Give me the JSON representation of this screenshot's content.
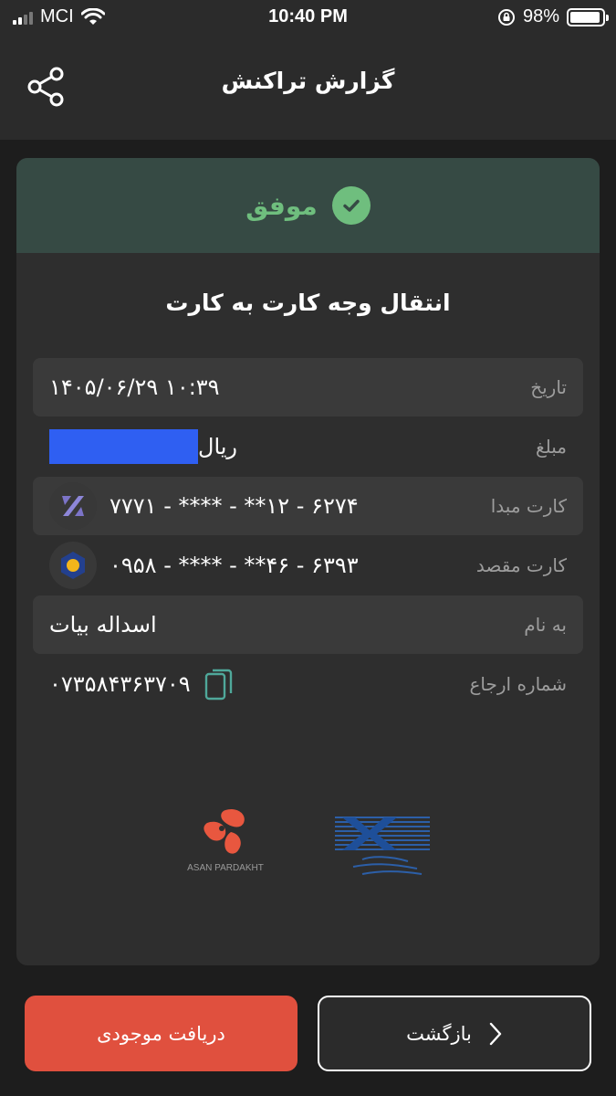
{
  "status_bar": {
    "carrier": "MCI",
    "time": "10:40 PM",
    "battery": "98%"
  },
  "header": {
    "title": "گزارش تراکنش",
    "share_icon": "share-icon"
  },
  "card": {
    "status_text": "موفق",
    "status_icon": "check-circle-icon",
    "title": "انتقال وجه کارت به کارت",
    "rows": {
      "date": {
        "label": "تاریخ",
        "value": "۱۴۰۵/۰۶/۲۹ ۱۰:۳۹"
      },
      "amount": {
        "label": "مبلغ",
        "value": "ریال"
      },
      "source_card": {
        "label": "کارت مبدا",
        "value": "۷۷۷۱ - **** - **۱۲ - ۶۲۷۴"
      },
      "dest_card": {
        "label": "کارت مقصد",
        "value": "۰۹۵۸ - **** - **۴۶ - ۶۳۹۳"
      },
      "name": {
        "label": "به نام",
        "value": "اسداله بیات"
      },
      "reference": {
        "label": "شماره ارجاع",
        "value": "۰۷۳۵۸۴۳۶۳۷۰۹"
      }
    },
    "logos": {
      "asan_pardakht": "ASAN PARDAKHT"
    }
  },
  "buttons": {
    "balance": "دریافت موجودی",
    "back": "بازگشت"
  },
  "colors": {
    "background": "#1d1d1d",
    "success": "#6fbe7e",
    "accent_red": "#e0503e",
    "mask_blue": "#2f5ff2"
  }
}
